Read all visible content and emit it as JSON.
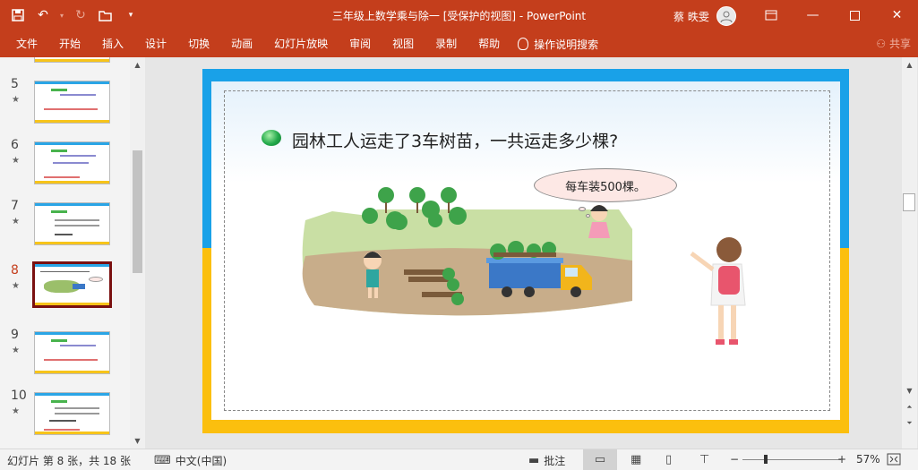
{
  "window": {
    "title": "三年级上数学乘与除一 [受保护的视图]  -  PowerPoint",
    "user_name": "蔡 昳雯",
    "quick_access": [
      "save-icon",
      "undo-icon",
      "redo-icon",
      "open-icon",
      "customize-icon"
    ]
  },
  "ribbon": {
    "tabs": [
      "文件",
      "开始",
      "插入",
      "设计",
      "切换",
      "动画",
      "幻灯片放映",
      "审阅",
      "视图",
      "录制",
      "帮助"
    ],
    "tell_me": "操作说明搜索",
    "share": "共享"
  },
  "thumbnails": [
    {
      "number": "5",
      "star": "★",
      "active": false
    },
    {
      "number": "6",
      "star": "★",
      "active": false
    },
    {
      "number": "7",
      "star": "★",
      "active": false
    },
    {
      "number": "8",
      "star": "★",
      "active": true
    },
    {
      "number": "9",
      "star": "★",
      "active": false
    },
    {
      "number": "10",
      "star": "★",
      "active": false
    }
  ],
  "slide": {
    "question": "园林工人运走了3车树苗，一共运走多少棵?",
    "speech_bubble": "每车装500棵。"
  },
  "statusbar": {
    "slide_info": "幻灯片 第 8 张，共 18 张",
    "language": "中文(中国)",
    "notes": "批注",
    "zoom_minus": "−",
    "zoom_plus": "+",
    "zoom": "57%"
  },
  "colors": {
    "accent": "#c43e1c",
    "frame_blue": "#19a1e8",
    "frame_yellow": "#fbbf0e",
    "active_thumb_border": "#7a1010"
  }
}
